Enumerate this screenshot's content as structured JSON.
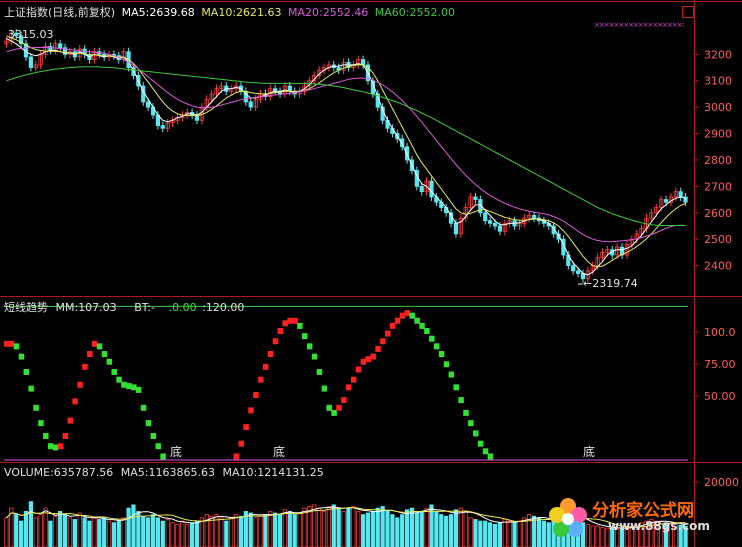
{
  "header": {
    "title": "上证指数(日线,前复权)",
    "ma5": "MA5:2639.68",
    "ma10": "MA10:2621.63",
    "ma20": "MA20:2552.46",
    "ma60": "MA60:2552.00",
    "high_note": "3315.03",
    "low_note": "2319.74"
  },
  "indicator": {
    "title": "短线趋势",
    "mm": "MM:107.03",
    "bt_label": "BT:-",
    "bt_value": ":0.00",
    "top_value": ":120.00",
    "bottom_marks": [
      "底",
      "底",
      "底"
    ]
  },
  "volume": {
    "vol": "VOLUME:635787.56",
    "ma5": "MA5:1163865.63",
    "ma10": "MA10:1214131.25"
  },
  "watermark": {
    "text": "分析家公式网",
    "url": "www.88gs.com"
  },
  "colors": {
    "up": "#ff3b3b",
    "down": "#56e8f0",
    "ma5": "#ffffff",
    "ma10": "#e8e85a",
    "ma20": "#d85ad8",
    "ma60": "#3ec83e",
    "axis": "#b01818",
    "label": "#ff5b5b",
    "indicator_up": "#ff2020",
    "indicator_down": "#33e033"
  },
  "chart_data": [
    {
      "type": "line",
      "title": "上证指数(日线,前复权)",
      "ylim": [
        2300,
        3330
      ],
      "yticks": [
        2400,
        2500,
        2600,
        2700,
        2800,
        2900,
        3000,
        3100,
        3200
      ],
      "ytick_labels": [
        "2400",
        "2500",
        "2600",
        "2700",
        "2800",
        "2900",
        "3000",
        "3100",
        "3200"
      ],
      "max_label": "3315.03",
      "min_label": "2319.74",
      "series": [
        {
          "name": "price",
          "values": [
            3250,
            3280,
            3270,
            3240,
            3190,
            3150,
            3160,
            3200,
            3230,
            3215,
            3240,
            3225,
            3200,
            3210,
            3190,
            3220,
            3200,
            3180,
            3210,
            3200,
            3190,
            3200,
            3195,
            3180,
            3210,
            3150,
            3120,
            3080,
            3020,
            3000,
            2970,
            2930,
            2920,
            2940,
            2950,
            2960,
            2970,
            2980,
            2970,
            2950,
            3000,
            3030,
            3050,
            3070,
            3080,
            3060,
            3070,
            3080,
            3060,
            3020,
            3000,
            3030,
            3050,
            3040,
            3070,
            3060,
            3050,
            3080,
            3060,
            3050,
            3060,
            3080,
            3100,
            3120,
            3140,
            3150,
            3160,
            3150,
            3140,
            3170,
            3150,
            3160,
            3180,
            3160,
            3100,
            3050,
            3000,
            2950,
            2920,
            2900,
            2880,
            2850,
            2800,
            2760,
            2700,
            2680,
            2720,
            2660,
            2640,
            2620,
            2600,
            2560,
            2520,
            2580,
            2620,
            2660,
            2650,
            2600,
            2570,
            2560,
            2550,
            2530,
            2560,
            2570,
            2550,
            2560,
            2580,
            2590,
            2580,
            2570,
            2560,
            2550,
            2520,
            2500,
            2440,
            2400,
            2380,
            2370,
            2350,
            2380,
            2400,
            2430,
            2450,
            2460,
            2440,
            2470,
            2440,
            2480,
            2500,
            2520,
            2540,
            2580,
            2600,
            2620,
            2650,
            2640,
            2660,
            2680,
            2660,
            2640
          ]
        },
        {
          "name": "MA5",
          "values": [
            3260,
            3250,
            3240,
            3225,
            3210,
            3200,
            3195,
            3200,
            3210,
            3215,
            3215,
            3210,
            3205,
            3205,
            3200,
            3210,
            3200,
            3190,
            3200,
            3195,
            3190,
            3195,
            3190,
            3185,
            3190,
            3170,
            3140,
            3100,
            3060,
            3030,
            3000,
            2970,
            2950,
            2945,
            2950,
            2960,
            2965,
            2975,
            2975,
            2970,
            2980,
            3000,
            3020,
            3040,
            3060,
            3070,
            3070,
            3075,
            3070,
            3050,
            3035,
            3035,
            3040,
            3045,
            3055,
            3060,
            3060,
            3065,
            3060,
            3055,
            3060,
            3070,
            3085,
            3105,
            3125,
            3140,
            3150,
            3155,
            3155,
            3160,
            3160,
            3160,
            3165,
            3160,
            3130,
            3090,
            3040,
            2990,
            2950,
            2920,
            2890,
            2860,
            2820,
            2780,
            2740,
            2710,
            2700,
            2680,
            2660,
            2640,
            2620,
            2590,
            2560,
            2565,
            2585,
            2610,
            2630,
            2630,
            2610,
            2590,
            2570,
            2555,
            2555,
            2560,
            2560,
            2562,
            2568,
            2575,
            2578,
            2575,
            2570,
            2560,
            2540,
            2515,
            2480,
            2440,
            2410,
            2390,
            2370,
            2365,
            2375,
            2395,
            2415,
            2440,
            2455,
            2460,
            2460,
            2465,
            2475,
            2495,
            2515,
            2540,
            2565,
            2590,
            2615,
            2630,
            2645,
            2655,
            2660,
            2655
          ]
        },
        {
          "name": "MA10",
          "values": [
            3270,
            3262,
            3255,
            3245,
            3235,
            3225,
            3218,
            3215,
            3212,
            3212,
            3212,
            3210,
            3208,
            3206,
            3204,
            3204,
            3202,
            3198,
            3198,
            3196,
            3194,
            3194,
            3192,
            3190,
            3190,
            3180,
            3165,
            3145,
            3120,
            3095,
            3070,
            3045,
            3020,
            3000,
            2985,
            2975,
            2970,
            2968,
            2968,
            2968,
            2972,
            2980,
            2992,
            3005,
            3020,
            3035,
            3045,
            3055,
            3060,
            3060,
            3055,
            3052,
            3050,
            3050,
            3052,
            3055,
            3057,
            3060,
            3060,
            3060,
            3060,
            3063,
            3070,
            3080,
            3092,
            3105,
            3118,
            3130,
            3140,
            3148,
            3154,
            3158,
            3160,
            3160,
            3150,
            3130,
            3100,
            3065,
            3030,
            2995,
            2960,
            2925,
            2890,
            2855,
            2820,
            2790,
            2765,
            2740,
            2715,
            2690,
            2665,
            2640,
            2615,
            2600,
            2595,
            2598,
            2605,
            2612,
            2612,
            2605,
            2598,
            2590,
            2583,
            2578,
            2574,
            2572,
            2572,
            2574,
            2576,
            2576,
            2574,
            2570,
            2562,
            2550,
            2532,
            2510,
            2485,
            2460,
            2435,
            2415,
            2400,
            2395,
            2398,
            2408,
            2420,
            2432,
            2442,
            2450,
            2460,
            2472,
            2486,
            2502,
            2520,
            2540,
            2562,
            2582,
            2600,
            2615,
            2628,
            2635
          ]
        },
        {
          "name": "MA20",
          "values": [
            3210,
            3215,
            3220,
            3222,
            3224,
            3225,
            3226,
            3226,
            3226,
            3225,
            3224,
            3222,
            3220,
            3218,
            3216,
            3214,
            3212,
            3210,
            3208,
            3206,
            3204,
            3200,
            3195,
            3188,
            3180,
            3170,
            3158,
            3145,
            3130,
            3115,
            3100,
            3085,
            3070,
            3055,
            3042,
            3030,
            3020,
            3012,
            3005,
            3000,
            2998,
            2998,
            3000,
            3003,
            3008,
            3013,
            3018,
            3023,
            3028,
            3032,
            3035,
            3037,
            3040,
            3042,
            3044,
            3046,
            3048,
            3050,
            3052,
            3055,
            3058,
            3062,
            3066,
            3070,
            3075,
            3080,
            3085,
            3090,
            3095,
            3100,
            3105,
            3108,
            3110,
            3110,
            3108,
            3102,
            3094,
            3084,
            3072,
            3058,
            3042,
            3025,
            3006,
            2986,
            2965,
            2943,
            2920,
            2897,
            2874,
            2851,
            2828,
            2805,
            2783,
            2762,
            2742,
            2724,
            2707,
            2692,
            2678,
            2666,
            2655,
            2645,
            2636,
            2628,
            2621,
            2615,
            2610,
            2606,
            2602,
            2599,
            2596,
            2592,
            2586,
            2578,
            2568,
            2556,
            2543,
            2530,
            2518,
            2508,
            2500,
            2495,
            2492,
            2490,
            2490,
            2492,
            2494,
            2496,
            2498,
            2502,
            2506,
            2512,
            2518,
            2525,
            2533,
            2541,
            2548,
            2552,
            2553,
            2552
          ]
        },
        {
          "name": "MA60",
          "values": [
            3100,
            3106,
            3112,
            3117,
            3122,
            3127,
            3131,
            3135,
            3138,
            3141,
            3144,
            3146,
            3148,
            3150,
            3151,
            3152,
            3153,
            3153,
            3153,
            3152,
            3151,
            3150,
            3149,
            3147,
            3145,
            3143,
            3141,
            3139,
            3137,
            3135,
            3133,
            3131,
            3129,
            3127,
            3125,
            3123,
            3121,
            3119,
            3117,
            3115,
            3113,
            3111,
            3109,
            3107,
            3105,
            3103,
            3101,
            3099,
            3097,
            3095,
            3093,
            3092,
            3091,
            3090,
            3090,
            3090,
            3090,
            3090,
            3090,
            3090,
            3090,
            3090,
            3089,
            3088,
            3087,
            3085,
            3083,
            3080,
            3077,
            3074,
            3070,
            3066,
            3062,
            3058,
            3053,
            3048,
            3043,
            3037,
            3031,
            3025,
            3018,
            3011,
            3003,
            2995,
            2987,
            2978,
            2969,
            2960,
            2950,
            2940,
            2930,
            2920,
            2910,
            2900,
            2890,
            2880,
            2870,
            2860,
            2850,
            2840,
            2830,
            2820,
            2810,
            2800,
            2790,
            2780,
            2770,
            2760,
            2750,
            2740,
            2730,
            2720,
            2710,
            2700,
            2690,
            2680,
            2670,
            2660,
            2650,
            2640,
            2630,
            2620,
            2612,
            2604,
            2596,
            2590,
            2584,
            2578,
            2572,
            2567,
            2562,
            2558,
            2555,
            2553,
            2552,
            2552,
            2552,
            2552,
            2552,
            2552
          ]
        }
      ]
    },
    {
      "type": "line",
      "title": "短线趋势",
      "ylim": [
        0,
        125
      ],
      "yticks": [
        50,
        75,
        100
      ],
      "ytick_labels": [
        "50.00",
        "75.00",
        "100.0"
      ],
      "reference_lines": [
        120,
        0
      ],
      "series": [
        {
          "name": "MM",
          "values": [
            90,
            90,
            88,
            80,
            68,
            55,
            40,
            28,
            18,
            10,
            9,
            10,
            18,
            30,
            45,
            58,
            72,
            82,
            90,
            88,
            82,
            76,
            68,
            62,
            58,
            57,
            56,
            54,
            40,
            28,
            18,
            10,
            2,
            0,
            0,
            0,
            0,
            0,
            0,
            0,
            0,
            0,
            0,
            0,
            0,
            0,
            0,
            2,
            12,
            25,
            38,
            50,
            62,
            72,
            82,
            92,
            100,
            106,
            108,
            108,
            104,
            96,
            88,
            80,
            68,
            55,
            40,
            36,
            40,
            46,
            56,
            62,
            70,
            76,
            78,
            80,
            86,
            92,
            98,
            104,
            108,
            112,
            114,
            112,
            108,
            104,
            100,
            94,
            88,
            82,
            74,
            66,
            56,
            46,
            36,
            28,
            20,
            12,
            6,
            2,
            0,
            0,
            0,
            0,
            0,
            0,
            0,
            0,
            0,
            0,
            0,
            0,
            0,
            0,
            0,
            0,
            0,
            0,
            0,
            0,
            0,
            0,
            0,
            0,
            0,
            0,
            0,
            0,
            0,
            0,
            0,
            0,
            0,
            0,
            0,
            0,
            0,
            0,
            0,
            0
          ]
        }
      ]
    },
    {
      "type": "bar",
      "title": "VOLUME",
      "ylim": [
        0,
        25000
      ],
      "yticks": [
        20000
      ],
      "ytick_labels": [
        "20000"
      ],
      "series": [
        {
          "name": "VOLUME",
          "values": [
            9000,
            12000,
            10000,
            8000,
            11000,
            14000,
            9000,
            10000,
            12000,
            8000,
            9500,
            11000,
            10000,
            9000,
            8500,
            10500,
            9000,
            8000,
            9000,
            8500,
            9000,
            8000,
            7500,
            8000,
            9000,
            12000,
            13000,
            11000,
            9500,
            9000,
            10000,
            9000,
            8000,
            8500,
            7500,
            7000,
            8000,
            7000,
            7500,
            8000,
            9000,
            10000,
            9500,
            10000,
            9000,
            8000,
            9000,
            10000,
            9500,
            11000,
            10500,
            9000,
            9500,
            10000,
            11000,
            10500,
            10000,
            11500,
            11000,
            10000,
            10500,
            12000,
            12500,
            13000,
            12000,
            11000,
            12500,
            13000,
            12000,
            11000,
            12000,
            12500,
            11000,
            10000,
            10500,
            11000,
            12000,
            12500,
            11000,
            10000,
            9000,
            10000,
            11500,
            12000,
            10500,
            11000,
            12000,
            13000,
            11000,
            10000,
            9500,
            10000,
            11500,
            12000,
            11000,
            9000,
            8500,
            8000,
            8000,
            7500,
            7000,
            7500,
            8500,
            8000,
            7500,
            8000,
            9000,
            10000,
            9500,
            9000,
            8000,
            7500,
            9000,
            10000,
            11000,
            10500,
            9500,
            8000,
            7500,
            7000,
            6500,
            6500,
            6000,
            5800,
            6000,
            5500,
            5800,
            6000,
            6500,
            7000,
            7500,
            8000,
            8500,
            8000,
            7800,
            7500,
            7000,
            7200,
            6800,
            6358
          ]
        }
      ]
    }
  ]
}
